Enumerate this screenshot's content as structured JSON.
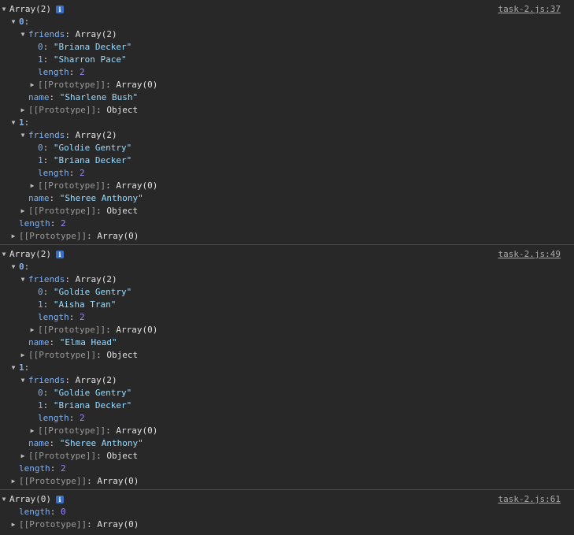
{
  "logs": [
    {
      "summary": "Array(2)",
      "source": "task-2.js:37",
      "rows": [
        {
          "indent": 1,
          "tri": "open",
          "key": "0",
          "keyStyle": "index",
          "value": "",
          "vtype": "val"
        },
        {
          "indent": 2,
          "tri": "open",
          "key": "friends",
          "keyStyle": "prop",
          "value": "Array(2)",
          "vtype": "val"
        },
        {
          "indent": 3,
          "tri": "none",
          "key": "0",
          "keyStyle": "prop",
          "value": "\"Briana Decker\"",
          "vtype": "str"
        },
        {
          "indent": 3,
          "tri": "none",
          "key": "1",
          "keyStyle": "prop",
          "value": "\"Sharron Pace\"",
          "vtype": "str"
        },
        {
          "indent": 3,
          "tri": "none",
          "key": "length",
          "keyStyle": "prop",
          "value": "2",
          "vtype": "num"
        },
        {
          "indent": 3,
          "tri": "closed",
          "key": "[[Prototype]]",
          "keyStyle": "proto",
          "value": "Array(0)",
          "vtype": "val"
        },
        {
          "indent": 2,
          "tri": "none",
          "key": "name",
          "keyStyle": "prop",
          "value": "\"Sharlene Bush\"",
          "vtype": "str"
        },
        {
          "indent": 2,
          "tri": "closed",
          "key": "[[Prototype]]",
          "keyStyle": "proto",
          "value": "Object",
          "vtype": "val"
        },
        {
          "indent": 1,
          "tri": "open",
          "key": "1",
          "keyStyle": "index",
          "value": "",
          "vtype": "val"
        },
        {
          "indent": 2,
          "tri": "open",
          "key": "friends",
          "keyStyle": "prop",
          "value": "Array(2)",
          "vtype": "val"
        },
        {
          "indent": 3,
          "tri": "none",
          "key": "0",
          "keyStyle": "prop",
          "value": "\"Goldie Gentry\"",
          "vtype": "str"
        },
        {
          "indent": 3,
          "tri": "none",
          "key": "1",
          "keyStyle": "prop",
          "value": "\"Briana Decker\"",
          "vtype": "str"
        },
        {
          "indent": 3,
          "tri": "none",
          "key": "length",
          "keyStyle": "prop",
          "value": "2",
          "vtype": "num"
        },
        {
          "indent": 3,
          "tri": "closed",
          "key": "[[Prototype]]",
          "keyStyle": "proto",
          "value": "Array(0)",
          "vtype": "val"
        },
        {
          "indent": 2,
          "tri": "none",
          "key": "name",
          "keyStyle": "prop",
          "value": "\"Sheree Anthony\"",
          "vtype": "str"
        },
        {
          "indent": 2,
          "tri": "closed",
          "key": "[[Prototype]]",
          "keyStyle": "proto",
          "value": "Object",
          "vtype": "val"
        },
        {
          "indent": 1,
          "tri": "none",
          "key": "length",
          "keyStyle": "prop",
          "value": "2",
          "vtype": "num"
        },
        {
          "indent": 1,
          "tri": "closed",
          "key": "[[Prototype]]",
          "keyStyle": "proto",
          "value": "Array(0)",
          "vtype": "val"
        }
      ]
    },
    {
      "summary": "Array(2)",
      "source": "task-2.js:49",
      "rows": [
        {
          "indent": 1,
          "tri": "open",
          "key": "0",
          "keyStyle": "index",
          "value": "",
          "vtype": "val"
        },
        {
          "indent": 2,
          "tri": "open",
          "key": "friends",
          "keyStyle": "prop",
          "value": "Array(2)",
          "vtype": "val"
        },
        {
          "indent": 3,
          "tri": "none",
          "key": "0",
          "keyStyle": "prop",
          "value": "\"Goldie Gentry\"",
          "vtype": "str"
        },
        {
          "indent": 3,
          "tri": "none",
          "key": "1",
          "keyStyle": "prop",
          "value": "\"Aisha Tran\"",
          "vtype": "str"
        },
        {
          "indent": 3,
          "tri": "none",
          "key": "length",
          "keyStyle": "prop",
          "value": "2",
          "vtype": "num"
        },
        {
          "indent": 3,
          "tri": "closed",
          "key": "[[Prototype]]",
          "keyStyle": "proto",
          "value": "Array(0)",
          "vtype": "val"
        },
        {
          "indent": 2,
          "tri": "none",
          "key": "name",
          "keyStyle": "prop",
          "value": "\"Elma Head\"",
          "vtype": "str"
        },
        {
          "indent": 2,
          "tri": "closed",
          "key": "[[Prototype]]",
          "keyStyle": "proto",
          "value": "Object",
          "vtype": "val"
        },
        {
          "indent": 1,
          "tri": "open",
          "key": "1",
          "keyStyle": "index",
          "value": "",
          "vtype": "val"
        },
        {
          "indent": 2,
          "tri": "open",
          "key": "friends",
          "keyStyle": "prop",
          "value": "Array(2)",
          "vtype": "val"
        },
        {
          "indent": 3,
          "tri": "none",
          "key": "0",
          "keyStyle": "prop",
          "value": "\"Goldie Gentry\"",
          "vtype": "str"
        },
        {
          "indent": 3,
          "tri": "none",
          "key": "1",
          "keyStyle": "prop",
          "value": "\"Briana Decker\"",
          "vtype": "str"
        },
        {
          "indent": 3,
          "tri": "none",
          "key": "length",
          "keyStyle": "prop",
          "value": "2",
          "vtype": "num"
        },
        {
          "indent": 3,
          "tri": "closed",
          "key": "[[Prototype]]",
          "keyStyle": "proto",
          "value": "Array(0)",
          "vtype": "val"
        },
        {
          "indent": 2,
          "tri": "none",
          "key": "name",
          "keyStyle": "prop",
          "value": "\"Sheree Anthony\"",
          "vtype": "str"
        },
        {
          "indent": 2,
          "tri": "closed",
          "key": "[[Prototype]]",
          "keyStyle": "proto",
          "value": "Object",
          "vtype": "val"
        },
        {
          "indent": 1,
          "tri": "none",
          "key": "length",
          "keyStyle": "prop",
          "value": "2",
          "vtype": "num"
        },
        {
          "indent": 1,
          "tri": "closed",
          "key": "[[Prototype]]",
          "keyStyle": "proto",
          "value": "Array(0)",
          "vtype": "val"
        }
      ]
    },
    {
      "summary": "Array(0)",
      "source": "task-2.js:61",
      "rows": [
        {
          "indent": 1,
          "tri": "none",
          "key": "length",
          "keyStyle": "prop",
          "value": "0",
          "vtype": "num"
        },
        {
          "indent": 1,
          "tri": "closed",
          "key": "[[Prototype]]",
          "keyStyle": "proto",
          "value": "Array(0)",
          "vtype": "val"
        }
      ]
    }
  ],
  "glyphs": {
    "open": "▼",
    "closed": "▶",
    "info": "i",
    "colon": ": "
  },
  "colors": {
    "background": "#282828",
    "key": "#7fb1f3",
    "string": "#9cdcfe",
    "number": "#9e86ff",
    "proto": "#9a9a9a"
  }
}
